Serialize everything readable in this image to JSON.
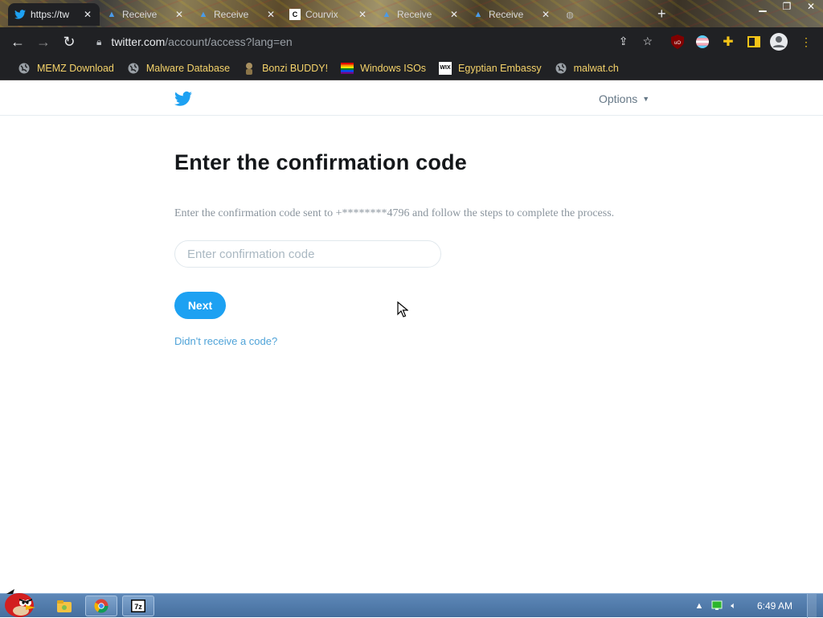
{
  "browser": {
    "tabs": [
      {
        "title": "https://tw",
        "icon": "twitter-icon",
        "active": true
      },
      {
        "title": "Receive",
        "icon": "alert-triangle-icon",
        "active": false
      },
      {
        "title": "Receive",
        "icon": "alert-triangle-icon",
        "active": false
      },
      {
        "title": "Courvix",
        "icon": "square-icon",
        "active": false
      },
      {
        "title": "Receive",
        "icon": "alert-triangle-icon",
        "active": false
      },
      {
        "title": "Receive",
        "icon": "alert-triangle-icon",
        "active": false
      }
    ],
    "url_host": "twitter.com",
    "url_path": "/account/access?lang=en",
    "bookmarks": [
      {
        "label": "MEMZ Download",
        "icon": "globe-icon"
      },
      {
        "label": "Malware Database",
        "icon": "globe-icon"
      },
      {
        "label": "Bonzi BUDDY!",
        "icon": "bonzi-icon"
      },
      {
        "label": "Windows ISOs",
        "icon": "rainbow-flag-icon"
      },
      {
        "label": "Egyptian Embassy",
        "icon": "wix-icon"
      },
      {
        "label": "malwat.ch",
        "icon": "globe-icon"
      }
    ]
  },
  "page": {
    "options_label": "Options",
    "heading": "Enter the confirmation code",
    "description": "Enter the confirmation code sent to +********4796 and follow the steps to complete the process.",
    "code_placeholder": "Enter confirmation code",
    "code_value": "",
    "next_label": "Next",
    "resend_link": "Didn't receive a code?"
  },
  "taskbar": {
    "time": "6:49 AM"
  },
  "colors": {
    "twitter_blue": "#1da1f2",
    "link_blue": "#4fa3d8",
    "bookmark_text": "#f5d36a",
    "chrome_dark": "#202124"
  }
}
